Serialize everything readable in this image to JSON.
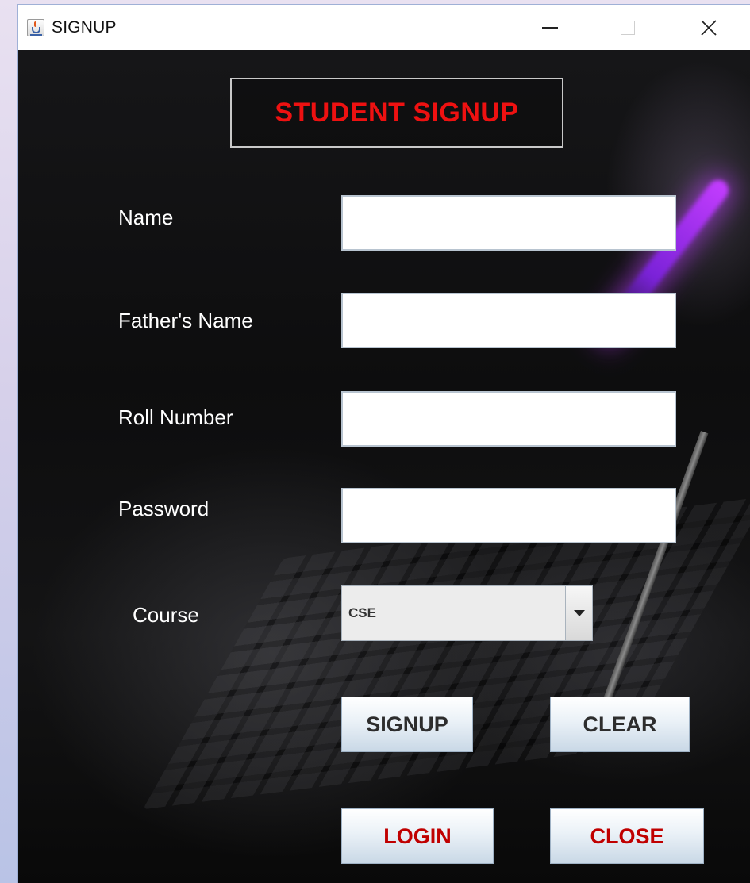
{
  "window": {
    "title": "SIGNUP",
    "icon": "java-cup-icon",
    "controls": {
      "minimize": "minimize-icon",
      "maximize": "maximize-icon",
      "close": "close-icon"
    }
  },
  "form": {
    "heading": "STUDENT SIGNUP",
    "heading_color": "#ee1111",
    "fields": {
      "name": {
        "label": "Name",
        "value": ""
      },
      "father_name": {
        "label": "Father's Name",
        "value": ""
      },
      "roll_number": {
        "label": "Roll Number",
        "value": ""
      },
      "password": {
        "label": "Password",
        "value": ""
      }
    },
    "course": {
      "label": "Course",
      "selected": "CSE"
    },
    "buttons": {
      "signup": "SIGNUP",
      "clear": "CLEAR",
      "login": "LOGIN",
      "close": "CLOSE"
    },
    "accent_button_text": "#c00000"
  }
}
